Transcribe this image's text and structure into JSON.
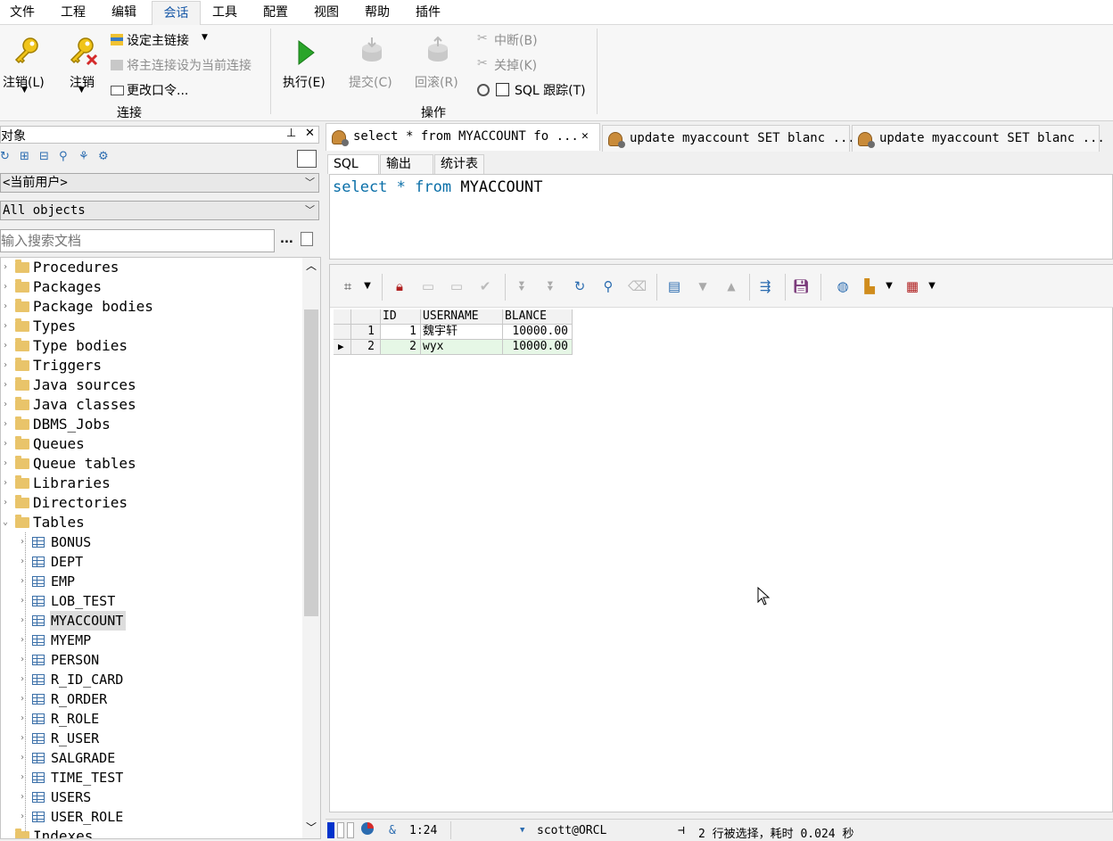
{
  "menu": [
    "文件",
    "工程",
    "编辑",
    "会话",
    "工具",
    "配置",
    "视图",
    "帮助",
    "插件"
  ],
  "menu_active": "会话",
  "ribbon": {
    "logon": "注销(L)",
    "logoff": "注销",
    "set_primary": "设定主链接",
    "set_primary_current": "将主连接设为当前连接",
    "change_password": "更改口令...",
    "group_connect": "连接",
    "execute": "执行(E)",
    "commit": "提交(C)",
    "rollback": "回滚(R)",
    "break": "中断(B)",
    "kill": "关掉(K)",
    "sql_trace": "SQL 跟踪(T)",
    "group_operation": "操作"
  },
  "left": {
    "title": "对象",
    "user_combo": "<当前用户>",
    "objects_combo": "All objects",
    "search_placeholder": "输入搜索文档",
    "more": "..."
  },
  "tree": {
    "folders": [
      "Procedures",
      "Packages",
      "Package bodies",
      "Types",
      "Type bodies",
      "Triggers",
      "Java sources",
      "Java classes",
      "DBMS_Jobs",
      "Queues",
      "Queue tables",
      "Libraries",
      "Directories",
      "Tables"
    ],
    "tables": [
      "BONUS",
      "DEPT",
      "EMP",
      "LOB_TEST",
      "MYACCOUNT",
      "MYEMP",
      "PERSON",
      "R_ID_CARD",
      "R_ORDER",
      "R_ROLE",
      "R_USER",
      "SALGRADE",
      "TIME_TEST",
      "USERS",
      "USER_ROLE"
    ],
    "selected_table": "MYACCOUNT",
    "last_partial": "Indexes"
  },
  "tabs": [
    {
      "label": "select * from MYACCOUNT fo ...",
      "close": "✕"
    },
    {
      "label": "update myaccount SET blanc ..."
    },
    {
      "label": "update myaccount SET blanc ..."
    }
  ],
  "subtabs": [
    "SQL",
    "输出",
    "统计表"
  ],
  "editor": {
    "kw1": "select",
    "star": "*",
    "kw2": "from",
    "table": "MYACCOUNT"
  },
  "grid": {
    "columns": [
      "ID",
      "USERNAME",
      "BLANCE"
    ],
    "rows": [
      {
        "rownum": "1",
        "id": "1",
        "username": "魏宇轩",
        "blance": "10000.00"
      },
      {
        "rownum": "2",
        "id": "2",
        "username": "wyx",
        "blance": "10000.00"
      }
    ]
  },
  "status": {
    "ampersand": "&",
    "position": "1:24",
    "connection": "scott@ORCL",
    "message": "2 行被选择，耗时 0.024 秒"
  },
  "colors": {
    "accent": "#1a5aa8",
    "execute_green": "#2aa52a",
    "folder": "#e9c46a",
    "row_green": "#e6f7e6"
  }
}
